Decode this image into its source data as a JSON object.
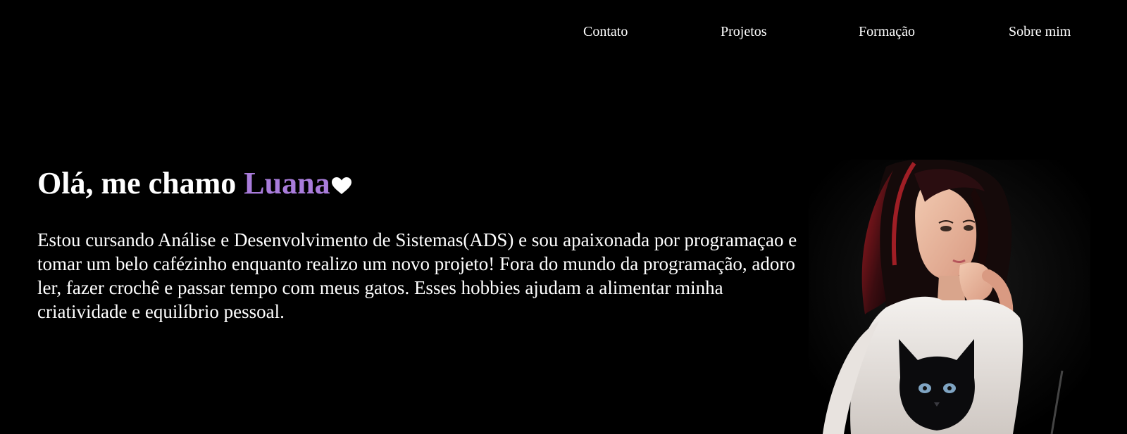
{
  "nav": {
    "items": [
      {
        "label": "Contato"
      },
      {
        "label": "Projetos"
      },
      {
        "label": "Formação"
      },
      {
        "label": "Sobre mim"
      }
    ]
  },
  "hero": {
    "title_prefix": "Olá, me chamo ",
    "title_name": "Luana",
    "name_color": "#a97cdb",
    "heart_icon": "heart-icon",
    "description": "Estou cursando Análise e Desenvolvimento de Sistemas(ADS) e sou apaixonada por programaçao e tomar um belo cafézinho enquanto realizo um novo projeto! Fora do mundo da programação, adoro ler, fazer crochê e passar tempo com meus gatos. Esses hobbies ajudam a alimentar minha criatividade e equilíbrio pessoal."
  },
  "colors": {
    "background": "#000000",
    "text": "#ffffff",
    "accent": "#a97cdb"
  }
}
